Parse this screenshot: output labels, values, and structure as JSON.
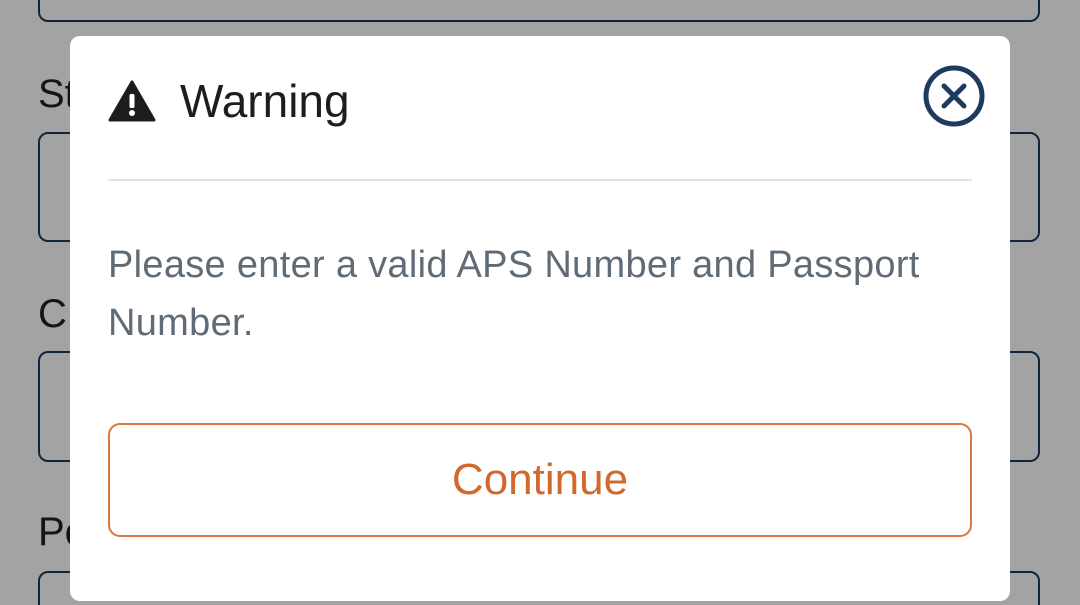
{
  "background_form": {
    "labels": [
      "St",
      "C",
      "Pc"
    ]
  },
  "modal": {
    "title": "Warning",
    "title_icon": "warning-triangle-icon",
    "close_icon": "close-circle-icon",
    "message": "Please enter a valid APS Number and Passport Number.",
    "continue_label": "Continue"
  },
  "colors": {
    "accent": "#d2682e",
    "close_icon": "#1f3a5f",
    "message_text": "#5f6b77",
    "title_text": "#1d1d1d"
  }
}
